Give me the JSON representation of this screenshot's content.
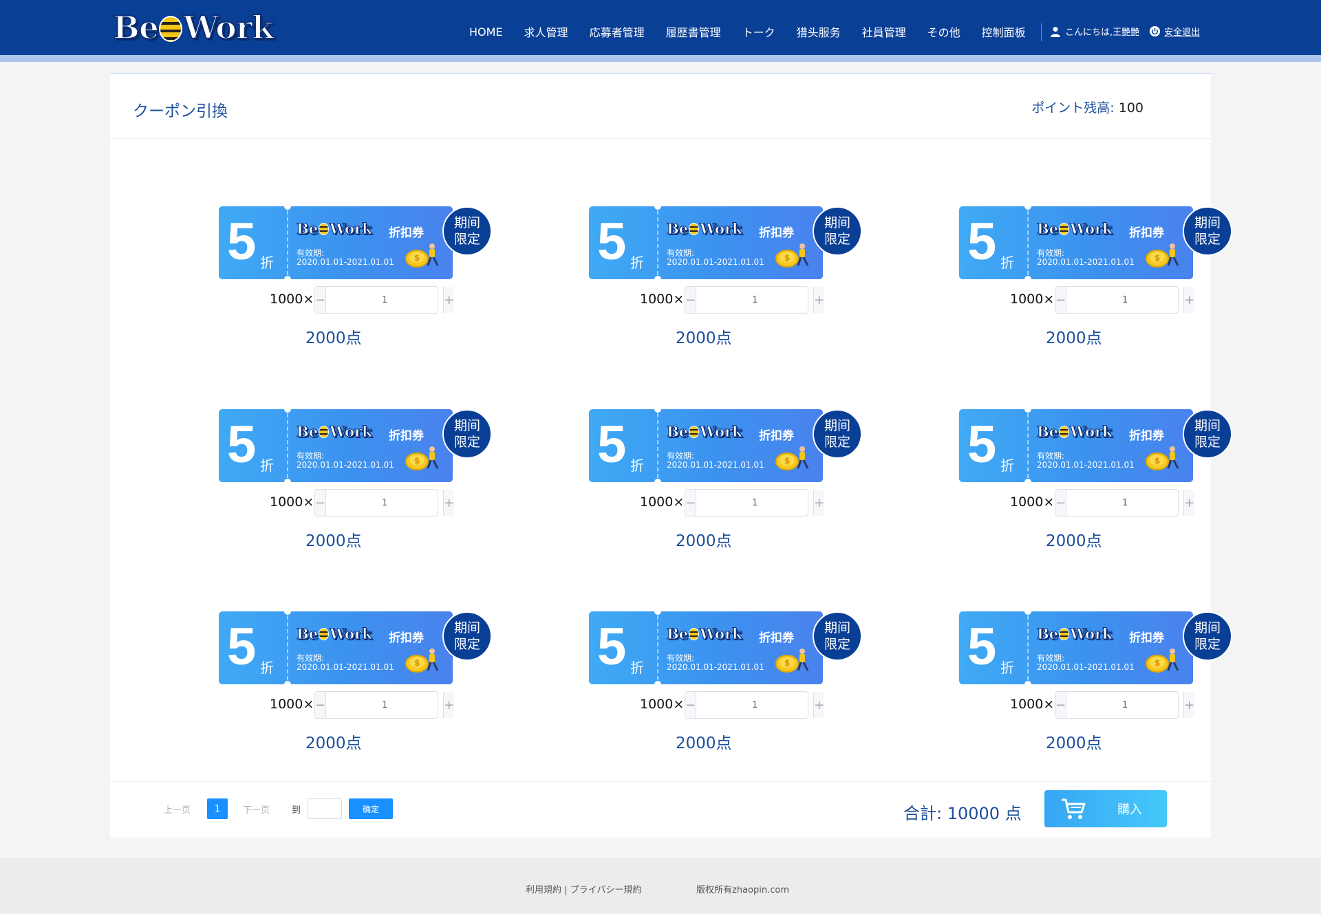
{
  "header": {
    "logo_text_left": "Be",
    "logo_text_right": "Work",
    "nav": [
      "HOME",
      "求人管理",
      "応募者管理",
      "履歴書管理",
      "トーク",
      "猎头服务",
      "社員管理",
      "その他",
      "控制面板"
    ],
    "greeting": "こんにちは,王艷艷",
    "logout": "安全退出"
  },
  "page": {
    "title": "クーポン引換",
    "balance_label": "ポイント残高:",
    "balance_value": "100"
  },
  "coupon": {
    "discount": "5",
    "discount_unit": "折",
    "brand_left": "Be",
    "brand_right": "Work",
    "type": "折扣券",
    "valid_label": "有效期:",
    "valid_dates": "2020.01.01-2021.01.01",
    "badge_line1": "期间",
    "badge_line2": "限定",
    "price_label": "1000×",
    "minus": "−",
    "plus": "+",
    "points_text": "2000点"
  },
  "coupons": [
    {
      "qty": "1"
    },
    {
      "qty": "1"
    },
    {
      "qty": "1"
    },
    {
      "qty": "1"
    },
    {
      "qty": "1"
    },
    {
      "qty": "1"
    },
    {
      "qty": "1"
    },
    {
      "qty": "1"
    },
    {
      "qty": "1"
    }
  ],
  "pagination": {
    "prev": "上一页",
    "current": "1",
    "next": "下一页",
    "goto_label": "到",
    "goto_value": "",
    "confirm": "确定"
  },
  "summary": {
    "total": "合計:  10000 点",
    "buy": "購入"
  },
  "footer": {
    "links": "利用規約 | プライバシー規約",
    "copyright": "版权所有zhaopin.com"
  },
  "colors": {
    "header_bg": "#0a3f96",
    "accent": "#1890ff",
    "title_text": "#1c4f9c"
  }
}
